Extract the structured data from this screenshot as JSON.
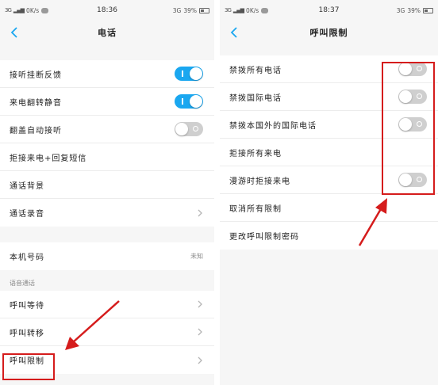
{
  "left": {
    "status": {
      "signal": "3G",
      "speed": "0K/s",
      "time": "18:36",
      "network": "3G",
      "battery": "39%"
    },
    "title": "电话",
    "section1": [
      {
        "label": "接听挂断反馈",
        "control": "toggle",
        "state": "on"
      },
      {
        "label": "来电翻转静音",
        "control": "toggle",
        "state": "on"
      },
      {
        "label": "翻盖自动接听",
        "control": "toggle",
        "state": "off"
      },
      {
        "label": "拒接来电+回复短信",
        "control": "none"
      },
      {
        "label": "通话背景",
        "control": "none"
      },
      {
        "label": "通话录音",
        "control": "chevron"
      }
    ],
    "section2": [
      {
        "label": "本机号码",
        "value": "未知"
      }
    ],
    "section3_header": "语音通话",
    "section3": [
      {
        "label": "呼叫等待",
        "control": "chevron"
      },
      {
        "label": "呼叫转移",
        "control": "chevron"
      },
      {
        "label": "呼叫限制",
        "control": "chevron"
      }
    ]
  },
  "right": {
    "status": {
      "signal": "3G",
      "speed": "0K/s",
      "time": "18:37",
      "network": "3G",
      "battery": "39%"
    },
    "title": "呼叫限制",
    "items": [
      {
        "label": "禁拨所有电话",
        "control": "toggle",
        "state": "off"
      },
      {
        "label": "禁拨国际电话",
        "control": "toggle",
        "state": "off"
      },
      {
        "label": "禁拨本国外的国际电话",
        "control": "toggle",
        "state": "off"
      },
      {
        "label": "拒接所有来电",
        "control": "none"
      },
      {
        "label": "漫游时拒接来电",
        "control": "toggle",
        "state": "off"
      },
      {
        "label": "取消所有限制",
        "control": "none"
      },
      {
        "label": "更改呼叫限制密码",
        "control": "none"
      }
    ]
  },
  "colors": {
    "toggle_on": "#1aa7f0",
    "toggle_off": "#cfcfcf",
    "annotation": "#d51c1c"
  },
  "icons": {
    "back": "chevron-left-icon",
    "row_arrow": "chevron-right-icon"
  }
}
